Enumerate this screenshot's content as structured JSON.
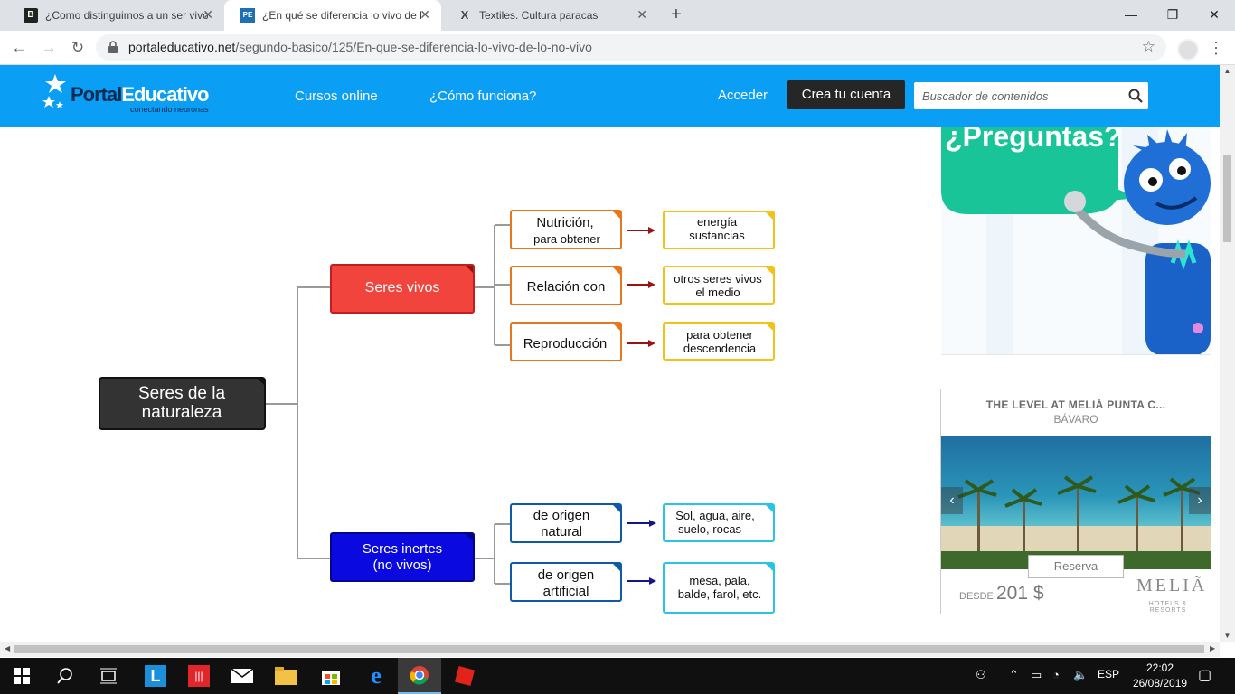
{
  "browser": {
    "tabs": [
      {
        "favicon": "B",
        "title": "¿Como distinguimos a un ser vivo"
      },
      {
        "favicon": "PE",
        "title": "¿En qué se diferencia lo vivo de l"
      },
      {
        "favicon": "X",
        "title": "Textiles. Cultura paracas"
      }
    ],
    "url_host": "portaleducativo.net",
    "url_path": "/segundo-basico/125/En-que-se-diferencia-lo-vivo-de-lo-no-vivo"
  },
  "site": {
    "logo_portal": "Portal",
    "logo_educativo": "Educativo",
    "logo_tagline": "conectando neuronas",
    "nav": [
      "Cursos online",
      "¿Cómo funciona?"
    ],
    "login": "Acceder",
    "signup": "Crea tu cuenta",
    "search_placeholder": "Buscador de contenidos"
  },
  "diagram": {
    "root": [
      "Seres de la",
      "naturaleza"
    ],
    "living": {
      "label": "Seres vivos",
      "functions": [
        {
          "label": [
            "Nutrición,",
            "para obtener"
          ],
          "result": [
            "energía",
            "sustancias"
          ]
        },
        {
          "label": [
            "Relación con"
          ],
          "result": [
            "otros seres vivos",
            "el medio"
          ]
        },
        {
          "label": [
            "Reproducción"
          ],
          "result": [
            "para obtener",
            "descendencia"
          ]
        }
      ]
    },
    "nonliving": {
      "label": [
        "Seres inertes",
        "(no vivos)"
      ],
      "origins": [
        {
          "label": [
            "de origen",
            "natural"
          ],
          "result": [
            "Sol, agua, aire,",
            "suelo, rocas"
          ]
        },
        {
          "label": [
            "de origen",
            "artificial"
          ],
          "result": [
            "mesa, pala,",
            "balde, farol, etc."
          ]
        }
      ]
    },
    "colors": {
      "root": "#333333",
      "living": "#f0443c",
      "nonliving": "#0a0ae0",
      "living_func_border": "#e8761e",
      "living_result_border": "#f2c218",
      "nonliving_border": "#0f5aa8",
      "nonliving_result_border": "#28c3e6",
      "living_arrow": "#9b1414",
      "nonliving_arrow": "#16168c"
    }
  },
  "ads": {
    "preguntas": "¿Preguntas?",
    "hotel_title": "THE LEVEL AT MELIÁ PUNTA C...",
    "hotel_location": "BÁVARO",
    "reserve": "Reserva",
    "price_prefix": "DESDE",
    "price": "201 $",
    "brand": "MELIÃ",
    "brand_sub": "HOTELS & RESORTS"
  },
  "taskbar": {
    "language": "ESP",
    "time": "22:02",
    "date": "26/08/2019"
  }
}
